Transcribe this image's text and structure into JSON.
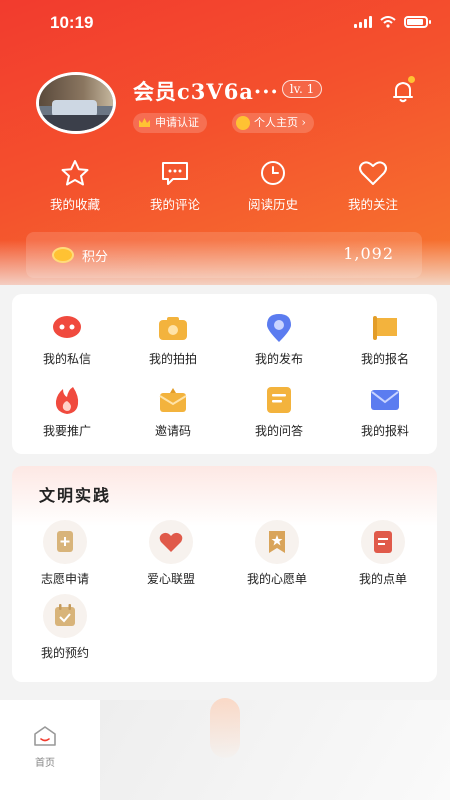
{
  "status_bar": {
    "time": "10:19"
  },
  "profile": {
    "username": "会员c3V6a···",
    "level": "lv. 1",
    "cert_label": "申请认证",
    "home_label": "个人主页 ›"
  },
  "quick_actions": [
    {
      "label": "我的收藏",
      "icon": "star-icon"
    },
    {
      "label": "我的评论",
      "icon": "comment-icon"
    },
    {
      "label": "阅读历史",
      "icon": "clock-icon"
    },
    {
      "label": "我的关注",
      "icon": "heart-icon"
    }
  ],
  "points": {
    "label": "积分",
    "value": "1,092"
  },
  "services": [
    {
      "label": "我的私信",
      "icon": "message-icon",
      "color": "#f04a3e"
    },
    {
      "label": "我的拍拍",
      "icon": "camera-icon",
      "color": "#f3b33d"
    },
    {
      "label": "我的发布",
      "icon": "location-pin-icon",
      "color": "#5b7cf0"
    },
    {
      "label": "我的报名",
      "icon": "flag-icon",
      "color": "#f3b33d"
    },
    {
      "label": "我要推广",
      "icon": "flame-icon",
      "color": "#f04a3e"
    },
    {
      "label": "邀请码",
      "icon": "gift-icon",
      "color": "#f3b33d"
    },
    {
      "label": "我的问答",
      "icon": "note-icon",
      "color": "#f3b33d"
    },
    {
      "label": "我的报料",
      "icon": "mail-icon",
      "color": "#5b7cf0"
    }
  ],
  "civilization": {
    "title": "文明实践",
    "items": [
      {
        "label": "志愿申请",
        "icon": "add-doc-icon",
        "color": "#d8b47a"
      },
      {
        "label": "爱心联盟",
        "icon": "heart-icon",
        "color": "#e05a4a"
      },
      {
        "label": "我的心愿单",
        "icon": "ribbon-icon",
        "color": "#d9a45a"
      },
      {
        "label": "我的点单",
        "icon": "list-icon",
        "color": "#e05a4a"
      },
      {
        "label": "我的预约",
        "icon": "calendar-check-icon",
        "color": "#d8b47a"
      }
    ]
  },
  "tabbar": {
    "home_label": "首页"
  },
  "colors": {
    "brand": "#f23b2e",
    "accent_gold": "#ffc233"
  }
}
